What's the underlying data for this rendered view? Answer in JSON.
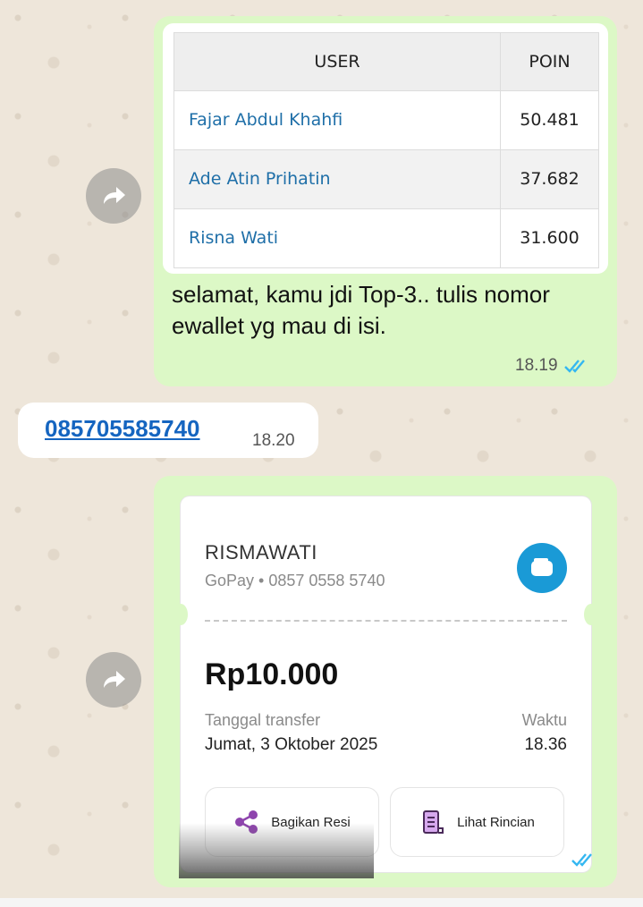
{
  "messages": {
    "leaderboard": {
      "headers": {
        "user": "USER",
        "points": "POIN"
      },
      "rows": [
        {
          "user": "Fajar Abdul Khahfi",
          "points": "50.481"
        },
        {
          "user": "Ade Atin Prihatin",
          "points": "37.682"
        },
        {
          "user": "Risna Wati",
          "points": "31.600"
        }
      ],
      "text": "selamat, kamu jdi Top-3.. tulis nomor ewallet yg mau di isi.",
      "time": "18.19"
    },
    "reply": {
      "phone": "085705585740",
      "time": "18.20"
    },
    "receipt": {
      "recipient": "RISMAWATI",
      "method": "GoPay • 0857 0558 5740",
      "amount": "Rp10.000",
      "date_label": "Tanggal transfer",
      "date_value": "Jumat, 3 Oktober 2025",
      "time_label": "Waktu",
      "time_value": "18.36",
      "share_button": "Bagikan Resi",
      "details_button": "Lihat Rincian"
    }
  },
  "colors": {
    "outgoing_bubble": "#dcf8c6",
    "incoming_bubble": "#ffffff",
    "link": "#1565c0",
    "read_ticks": "#34b7f1",
    "gopay_blue": "#1a9ad6"
  }
}
